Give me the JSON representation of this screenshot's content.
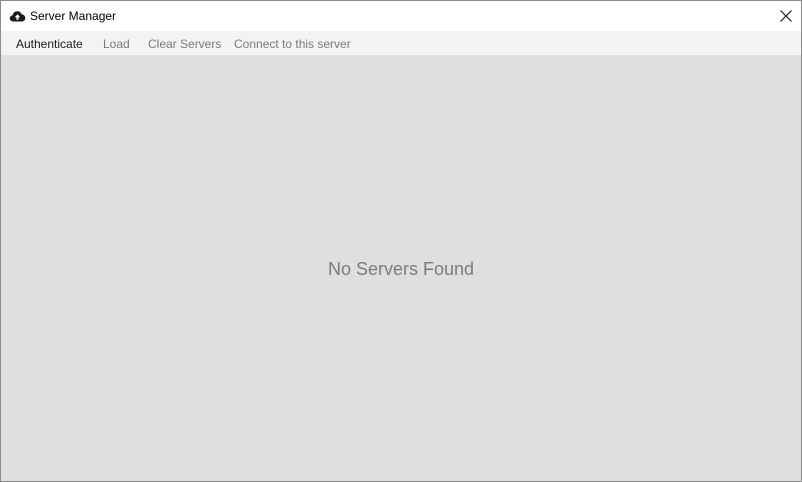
{
  "window": {
    "title": "Server Manager",
    "app_icon": "cloud-upload-icon",
    "close_icon": "close-icon"
  },
  "toolbar": {
    "items": [
      {
        "label": "Authenticate",
        "state": "enabled"
      },
      {
        "label": "Load",
        "state": "disabled"
      },
      {
        "label": "Clear Servers",
        "state": "disabled"
      },
      {
        "label": "Connect to this server",
        "state": "disabled"
      }
    ]
  },
  "content": {
    "empty_message": "No Servers Found"
  },
  "colors": {
    "titlebar_bg": "#ffffff",
    "toolbar_bg": "#f3f3f3",
    "content_bg": "#dfdfdf",
    "enabled_text": "#1a1a1a",
    "disabled_text": "#7a7a7a",
    "empty_text": "#7b7b7b"
  }
}
